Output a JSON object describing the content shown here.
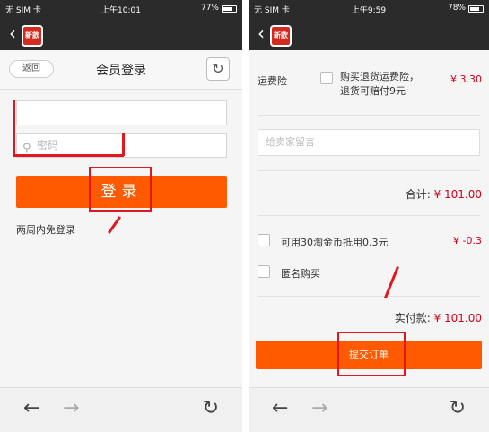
{
  "left": {
    "status": {
      "carrier": "无 SIM 卡",
      "time": "上午10:01",
      "battery": "77%",
      "battery_level": 0.77
    },
    "app_logo": "新款",
    "nav": {
      "back_label": "返回",
      "title": "会员登录"
    },
    "login": {
      "username_placeholder": "",
      "password_placeholder": "密码",
      "button_label": "登录",
      "remember_label": "两周内免登录"
    }
  },
  "right": {
    "status": {
      "carrier": "无 SIM 卡",
      "time": "上午9:59",
      "battery": "78%",
      "battery_level": 0.78
    },
    "app_logo": "新款",
    "shipping_insurance": {
      "label": "运费险",
      "option_line1": "购买退货运费险，",
      "option_line2": "退货可赔付9元",
      "price": "¥ 3.30"
    },
    "message_placeholder": "给卖家留言",
    "subtotal": {
      "label": "合计:",
      "amount": "¥ 101.00"
    },
    "taobao_coins": {
      "label": "可用30淘金币抵用0.3元",
      "amount": "¥ -0.3"
    },
    "anonymous_label": "匿名购买",
    "payable": {
      "label": "实付款:",
      "amount": "¥ 101.00"
    },
    "submit_label": "提交订单"
  },
  "colors": {
    "accent": "#ff5a00",
    "annotation_red": "#e2171f",
    "price_red": "#d0021b",
    "topbar": "#2b2b2b"
  }
}
